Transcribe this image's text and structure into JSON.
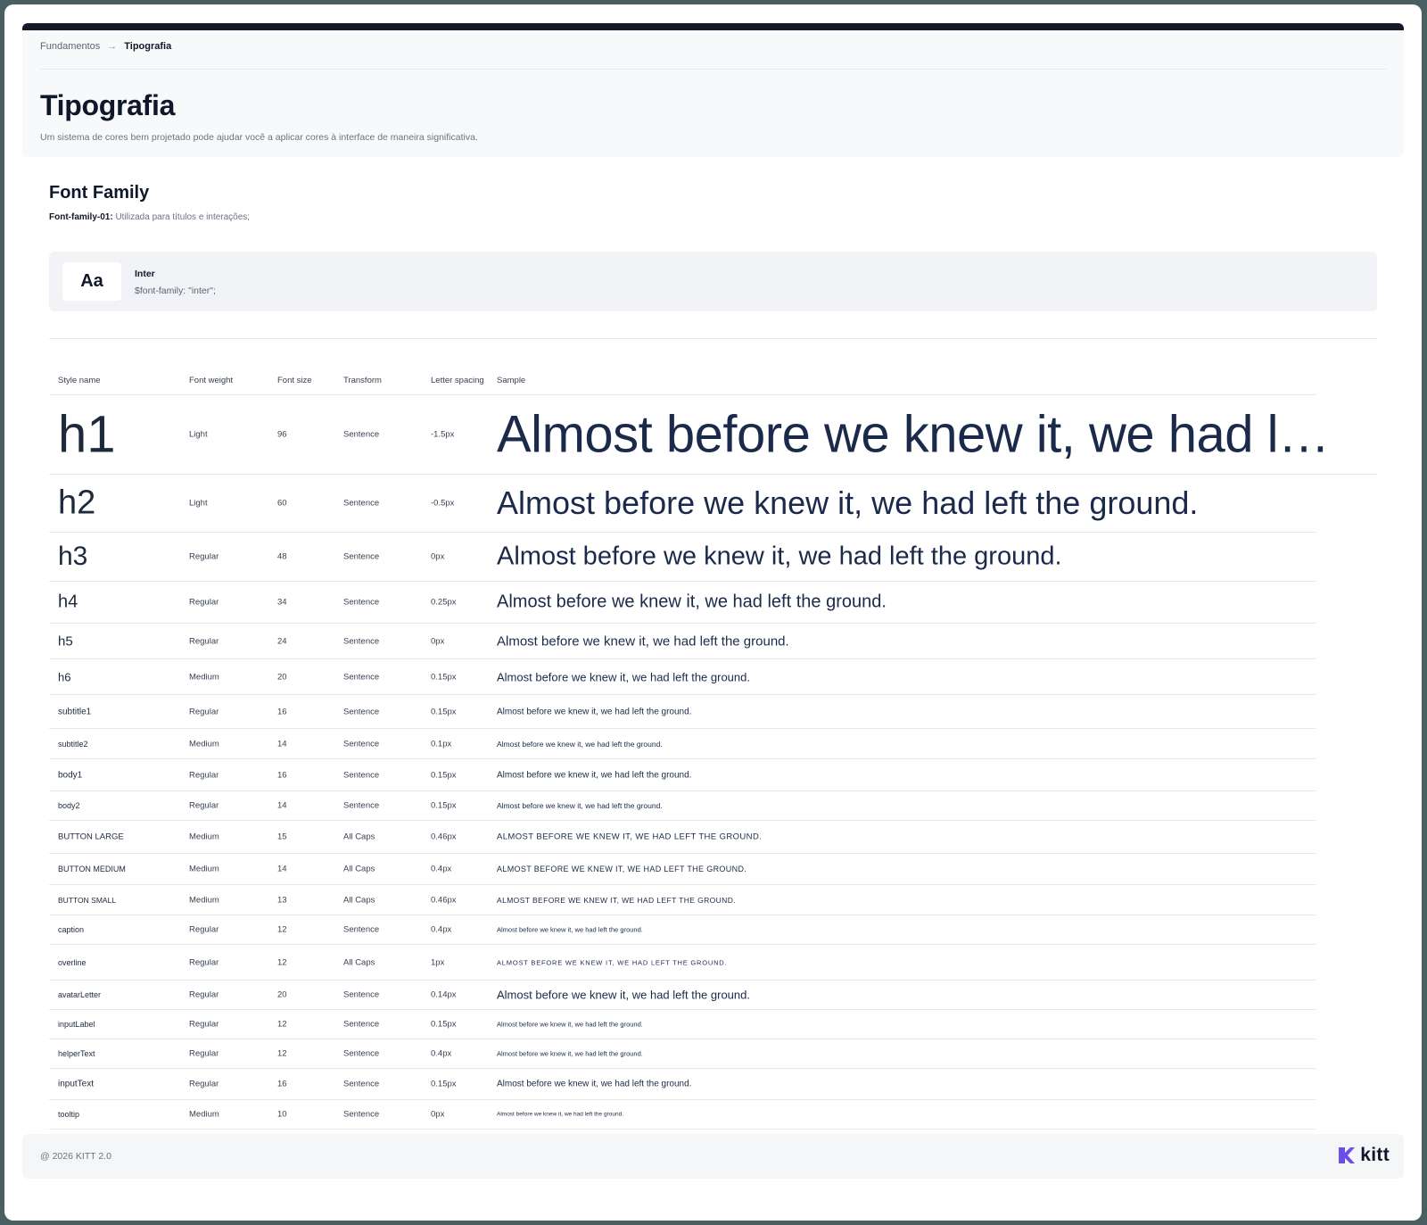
{
  "breadcrumb": {
    "parent": "Fundamentos",
    "current": "Tipografia"
  },
  "page": {
    "title": "Tipografia",
    "description": "Um sistema de cores bem projetado pode ajudar você a aplicar cores à interface de maneira significativa."
  },
  "font_family": {
    "title": "Font Family",
    "label": "Font-family-01:",
    "desc": " Utilizada para títulos e interações;",
    "card": {
      "aa": "Aa",
      "name": "Inter",
      "var": "$font-family: \"inter\";"
    }
  },
  "table": {
    "headers": {
      "style": "Style name",
      "weight": "Font weight",
      "size": "Font size",
      "transform": "Transform",
      "spacing": "Letter spacing",
      "sample": "Sample"
    },
    "rows": [
      {
        "name": "h1",
        "weight": "Light",
        "size": "96",
        "transform": "Sentence",
        "spacing": "-1.5px",
        "sample": "Almost before we knew it, we had left the ground."
      },
      {
        "name": "h2",
        "weight": "Light",
        "size": "60",
        "transform": "Sentence",
        "spacing": "-0.5px",
        "sample": "Almost before we knew it, we had left the ground."
      },
      {
        "name": "h3",
        "weight": "Regular",
        "size": "48",
        "transform": "Sentence",
        "spacing": "0px",
        "sample": "Almost before we knew it, we had left the ground."
      },
      {
        "name": "h4",
        "weight": "Regular",
        "size": "34",
        "transform": "Sentence",
        "spacing": "0.25px",
        "sample": "Almost before we knew it, we had left the ground."
      },
      {
        "name": "h5",
        "weight": "Regular",
        "size": "24",
        "transform": "Sentence",
        "spacing": "0px",
        "sample": "Almost before we knew it, we had left the ground."
      },
      {
        "name": "h6",
        "weight": "Medium",
        "size": "20",
        "transform": "Sentence",
        "spacing": "0.15px",
        "sample": "Almost before we knew it, we had left the ground."
      },
      {
        "name": "subtitle1",
        "weight": "Regular",
        "size": "16",
        "transform": "Sentence",
        "spacing": "0.15px",
        "sample": "Almost before we knew it, we had left the ground."
      },
      {
        "name": "subtitle2",
        "weight": "Medium",
        "size": "14",
        "transform": "Sentence",
        "spacing": "0.1px",
        "sample": "Almost before we knew it, we had left the ground."
      },
      {
        "name": "body1",
        "weight": "Regular",
        "size": "16",
        "transform": "Sentence",
        "spacing": "0.15px",
        "sample": "Almost before we knew it, we had left the ground."
      },
      {
        "name": "body2",
        "weight": "Regular",
        "size": "14",
        "transform": "Sentence",
        "spacing": "0.15px",
        "sample": "Almost before we knew it, we had left the ground."
      },
      {
        "name": "BUTTON LARGE",
        "weight": "Medium",
        "size": "15",
        "transform": "All Caps",
        "spacing": "0.46px",
        "sample": "ALMOST BEFORE WE KNEW IT, WE HAD LEFT THE GROUND."
      },
      {
        "name": "BUTTON MEDIUM",
        "weight": "Medium",
        "size": "14",
        "transform": "All Caps",
        "spacing": "0.4px",
        "sample": "ALMOST BEFORE WE KNEW IT, WE HAD LEFT THE GROUND."
      },
      {
        "name": "BUTTON SMALL",
        "weight": "Medium",
        "size": "13",
        "transform": "All Caps",
        "spacing": "0.46px",
        "sample": "ALMOST BEFORE WE KNEW IT, WE HAD LEFT THE GROUND."
      },
      {
        "name": "caption",
        "weight": "Regular",
        "size": "12",
        "transform": "Sentence",
        "spacing": "0.4px",
        "sample": "Almost before we knew it, we had left the ground."
      },
      {
        "name": "overline",
        "weight": "Regular",
        "size": "12",
        "transform": "All Caps",
        "spacing": "1px",
        "sample": "ALMOST BEFORE WE KNEW IT, WE HAD LEFT THE GROUND."
      },
      {
        "name": "avatarLetter",
        "weight": "Regular",
        "size": "20",
        "transform": "Sentence",
        "spacing": "0.14px",
        "sample": "Almost before we knew it, we had left the ground."
      },
      {
        "name": "inputLabel",
        "weight": "Regular",
        "size": "12",
        "transform": "Sentence",
        "spacing": "0.15px",
        "sample": "Almost before we knew it, we had left the ground."
      },
      {
        "name": "helperText",
        "weight": "Regular",
        "size": "12",
        "transform": "Sentence",
        "spacing": "0.4px",
        "sample": "Almost before we knew it, we had left the ground."
      },
      {
        "name": "inputText",
        "weight": "Regular",
        "size": "16",
        "transform": "Sentence",
        "spacing": "0.15px",
        "sample": "Almost before we knew it, we had left the ground."
      },
      {
        "name": "tooltip",
        "weight": "Medium",
        "size": "10",
        "transform": "Sentence",
        "spacing": "0px",
        "sample": "Almost before we knew it, we had left the ground."
      }
    ]
  },
  "footer": {
    "copyright": "@ 2026 KITT 2.0",
    "logo_text": "kitt",
    "logo_icon": "kitt-logo-icon",
    "logo_color": "#6d4ee8"
  }
}
